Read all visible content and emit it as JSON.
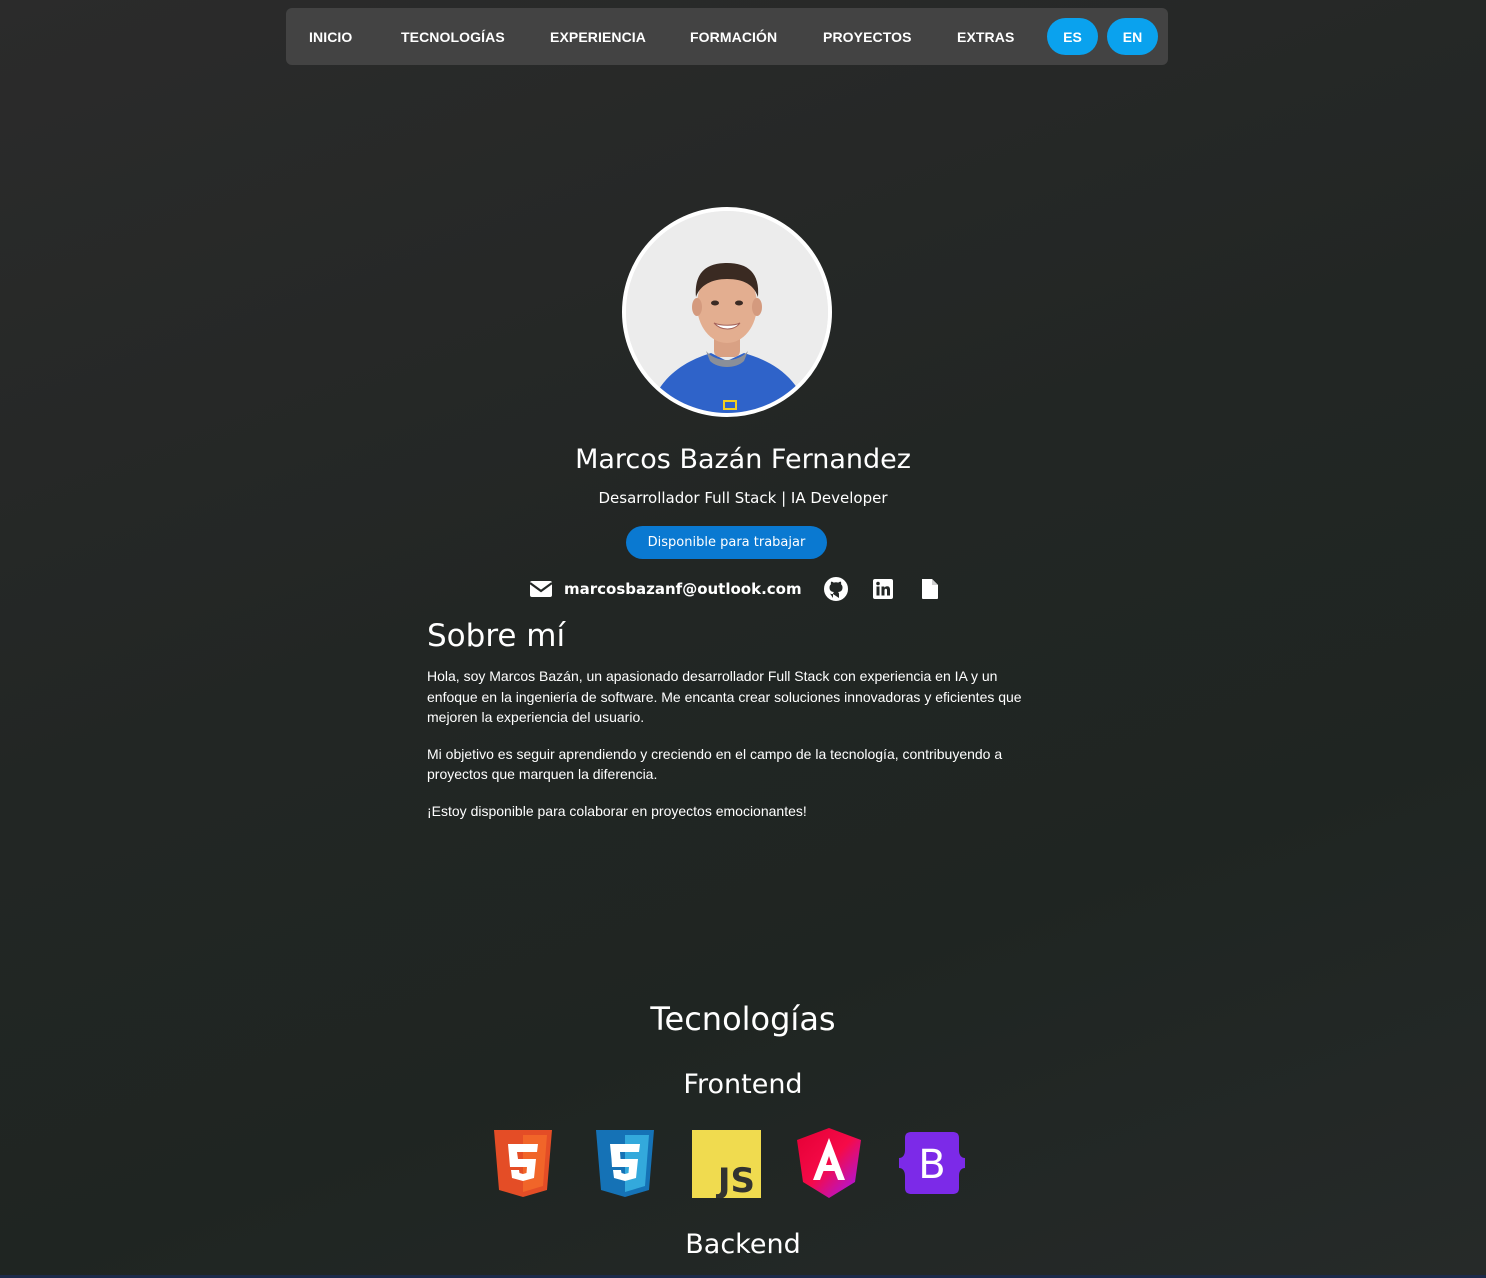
{
  "nav": {
    "items": [
      "INICIO",
      "TECNOLOGÍAS",
      "EXPERIENCIA",
      "FORMACIÓN",
      "PROYECTOS",
      "EXTRAS"
    ],
    "lang": [
      "ES",
      "EN"
    ]
  },
  "profile": {
    "name": "Marcos Bazán Fernandez",
    "subtitle": "Desarrollador Full Stack | IA Developer",
    "status": "Disponible para trabajar",
    "email": "marcosbazanf@outlook.com"
  },
  "about": {
    "title": "Sobre mí",
    "paragraphs": [
      "Hola, soy Marcos Bazán, un apasionado desarrollador Full Stack con experiencia en IA y un enfoque en la ingeniería de software. Me encanta crear soluciones innovadoras y eficientes que mejoren la experiencia del usuario.",
      "Mi objetivo es seguir aprendiendo y creciendo en el campo de la tecnología, contribuyendo a proyectos que marquen la diferencia.",
      "¡Estoy disponible para colaborar en proyectos emocionantes!"
    ]
  },
  "tech": {
    "title": "Tecnologías",
    "frontend_title": "Frontend",
    "backend_title": "Backend",
    "frontend_icons": [
      "html5-icon",
      "css3-icon",
      "javascript-icon",
      "angular-icon",
      "bootstrap-icon"
    ]
  },
  "icons": {
    "email": "envelope-icon",
    "github": "github-icon",
    "linkedin": "linkedin-icon",
    "cv": "file-icon"
  },
  "colors": {
    "accent": "#0aa2ee",
    "status_button": "#0a79d1",
    "nav_bg": "#434343"
  }
}
